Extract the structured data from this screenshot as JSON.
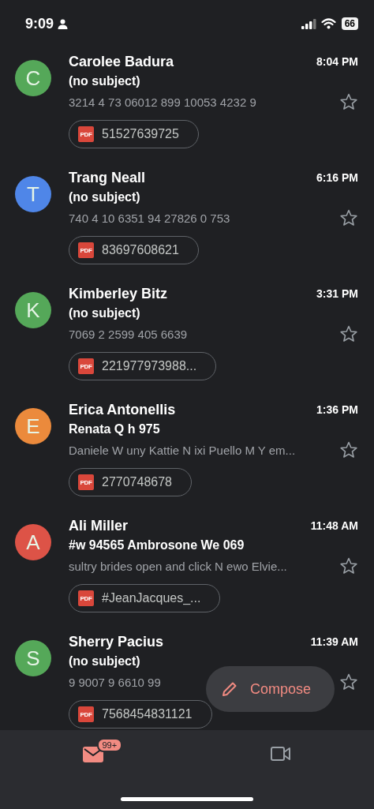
{
  "status_bar": {
    "time": "9:09",
    "battery": "66"
  },
  "emails": [
    {
      "sender": "Carolee Badura",
      "initial": "C",
      "color": "#55a859",
      "time": "8:04 PM",
      "subject": "(no subject)",
      "snippet": "3214 4 73 06012 899 10053 4232 9",
      "starred": false,
      "attachment": "51527639725",
      "file_type": "PDF"
    },
    {
      "sender": "Trang Neall",
      "initial": "T",
      "color": "#4f86e8",
      "time": "6:16 PM",
      "subject": "(no subject)",
      "snippet": "740 4 10 6351 94 27826 0 753",
      "starred": false,
      "attachment": "83697608621",
      "file_type": "PDF"
    },
    {
      "sender": "Kimberley Bitz",
      "initial": "K",
      "color": "#55a859",
      "time": "3:31 PM",
      "subject": "(no subject)",
      "snippet": "7069 2 2599 405 6639",
      "starred": false,
      "attachment": "221977973988...",
      "file_type": "PDF"
    },
    {
      "sender": "Erica Antonellis",
      "initial": "E",
      "color": "#eb8a3c",
      "time": "1:36 PM",
      "subject": "Renata  Q  h 975",
      "snippet": "Daniele W uny Kattie N ixi Puello M Y em...",
      "starred": false,
      "attachment": "2770748678",
      "file_type": "PDF"
    },
    {
      "sender": "Ali Miller",
      "initial": "A",
      "color": "#dd5347",
      "time": "11:48 AM",
      "subject": "#w 94565 Ambrosone  We  069",
      "snippet": "sultry brides open and click N ewo Elvie...",
      "starred": false,
      "attachment": "#JeanJacques_...",
      "file_type": "PDF"
    },
    {
      "sender": "Sherry Pacius",
      "initial": "S",
      "color": "#55a859",
      "time": "11:39 AM",
      "subject": "(no subject)",
      "snippet": "9 9007 9 6610 99",
      "starred": false,
      "attachment": "7568454831121",
      "file_type": "PDF"
    }
  ],
  "compose": {
    "label": "Compose"
  },
  "nav": [
    {
      "kind": "mail",
      "selected": true,
      "badge": "99+"
    },
    {
      "kind": "video",
      "selected": false
    }
  ]
}
